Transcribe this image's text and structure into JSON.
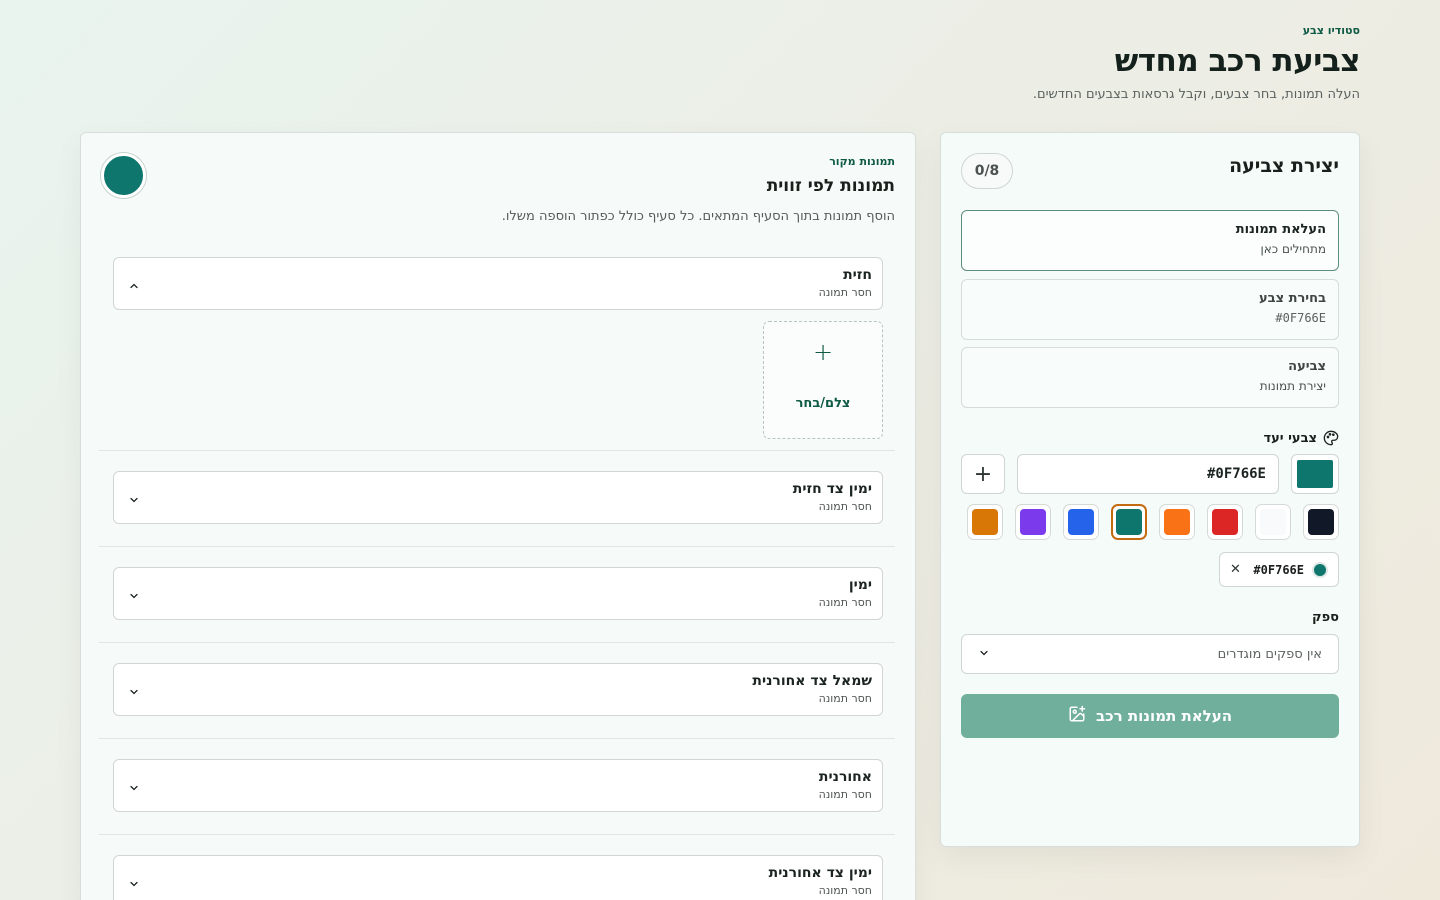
{
  "header": {
    "eyebrow": "סטודיו צבע",
    "title": "צביעת רכב מחדש",
    "subtitle": "העלה תמונות, בחר צבעים, וקבל גרסאות בצבעים החדשים."
  },
  "create_panel": {
    "title": "יצירת צביעה",
    "counter": "0/8",
    "steps": [
      {
        "title": "העלאת תמונות",
        "sub": "מתחילים כאן"
      },
      {
        "title": "בחירת צבע",
        "sub": "#0F766E"
      },
      {
        "title": "צביעה",
        "sub": "יצירת תמונות"
      }
    ],
    "target_colors_label": "צבעי יעד",
    "hex_value": "#0F766E",
    "current_color": "#0F766E",
    "swatches": [
      "#111827",
      "#F9FAFB",
      "#DC2626",
      "#F97316",
      "#0F766E",
      "#2563EB",
      "#7C3AED",
      "#D97706"
    ],
    "selected_swatch": "#0F766E",
    "selected_chip": "#0F766E",
    "provider_label": "ספק",
    "provider_value": "אין ספקים מוגדרים",
    "upload_button": "העלאת תמונות רכב"
  },
  "source_panel": {
    "eyebrow": "תמונות מקור",
    "title": "תמונות לפי זווית",
    "description": "הוסף תמונות בתוך הסעיף המתאים. כל סעיף כולל כפתור הוספה משלו.",
    "add_photo_label": "צלם/בחר",
    "angles": [
      {
        "name": "חזית",
        "status": "חסר תמונה",
        "expanded": true
      },
      {
        "name": "ימין צד חזית",
        "status": "חסר תמונה",
        "expanded": false
      },
      {
        "name": "ימין",
        "status": "חסר תמונה",
        "expanded": false
      },
      {
        "name": "שמאל צד אחורנית",
        "status": "חסר תמונה",
        "expanded": false
      },
      {
        "name": "אחורנית",
        "status": "חסר תמונה",
        "expanded": false
      },
      {
        "name": "ימין צד אחורנית",
        "status": "חסר תמונה",
        "expanded": false
      }
    ]
  }
}
